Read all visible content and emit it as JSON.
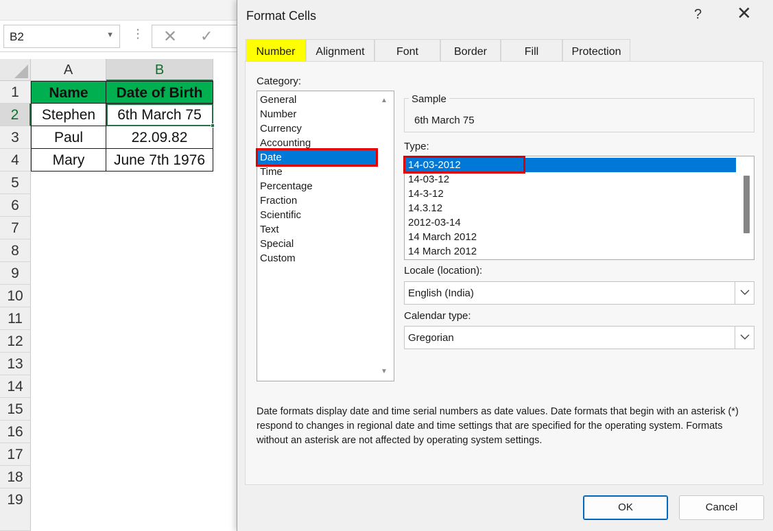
{
  "excel": {
    "name_box": "B2",
    "columns": [
      "A",
      "B"
    ],
    "rows": [
      "1",
      "2",
      "3",
      "4",
      "5",
      "6",
      "7",
      "8",
      "9",
      "10",
      "11",
      "12",
      "13",
      "14",
      "15",
      "16",
      "17",
      "18",
      "19"
    ],
    "header_cells": [
      "Name",
      "Date of Birth"
    ],
    "data_rows": [
      [
        "Stephen",
        "6th March 75"
      ],
      [
        "Paul",
        "22.09.82"
      ],
      [
        "Mary",
        "June 7th 1976"
      ]
    ],
    "header_fill_color": "#00b050",
    "selection_color": "#217346"
  },
  "dialog": {
    "title": "Format Cells",
    "help_label": "?",
    "close_label": "✕",
    "tabs": [
      "Number",
      "Alignment",
      "Font",
      "Border",
      "Fill",
      "Protection"
    ],
    "active_tab": "Number",
    "category_label": "Category:",
    "categories": [
      "General",
      "Number",
      "Currency",
      "Accounting",
      "Date",
      "Time",
      "Percentage",
      "Fraction",
      "Scientific",
      "Text",
      "Special",
      "Custom"
    ],
    "selected_category": "Date",
    "sample_label": "Sample",
    "sample_value": "6th March 75",
    "type_label": "Type:",
    "types": [
      "14-03-2012",
      "14-03-12",
      "14-3-12",
      "14.3.12",
      "2012-03-14",
      "14 March 2012",
      "14 March 2012"
    ],
    "selected_type": "14-03-2012",
    "locale_label": "Locale (location):",
    "locale_value": "English (India)",
    "calendar_label": "Calendar type:",
    "calendar_value": "Gregorian",
    "description": "Date formats display date and time serial numbers as date values.  Date formats that begin with an asterisk (*) respond to changes in regional date and time settings that are specified for the operating system. Formats without an asterisk are not affected by operating system settings.",
    "ok_label": "OK",
    "cancel_label": "Cancel",
    "accent_color": "#0078d7",
    "highlight_color": "#ffff00",
    "annotation_color": "#e00000"
  }
}
